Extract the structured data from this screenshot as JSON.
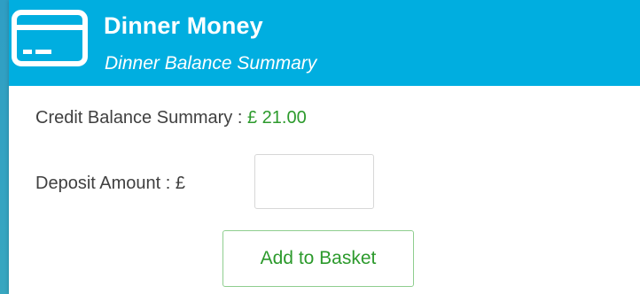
{
  "header": {
    "title": "Dinner Money",
    "subtitle": "Dinner Balance Summary",
    "icon": "credit-card-icon"
  },
  "balance": {
    "label": "Credit Balance Summary : ",
    "value": "£ 21.00"
  },
  "deposit": {
    "label": "Deposit Amount : £",
    "value": ""
  },
  "actions": {
    "add_to_basket_label": "Add to Basket"
  },
  "colors": {
    "header_bg": "#00aee0",
    "accent_green": "#2c9a2c",
    "button_border": "#8fce8f",
    "text": "#404040"
  }
}
